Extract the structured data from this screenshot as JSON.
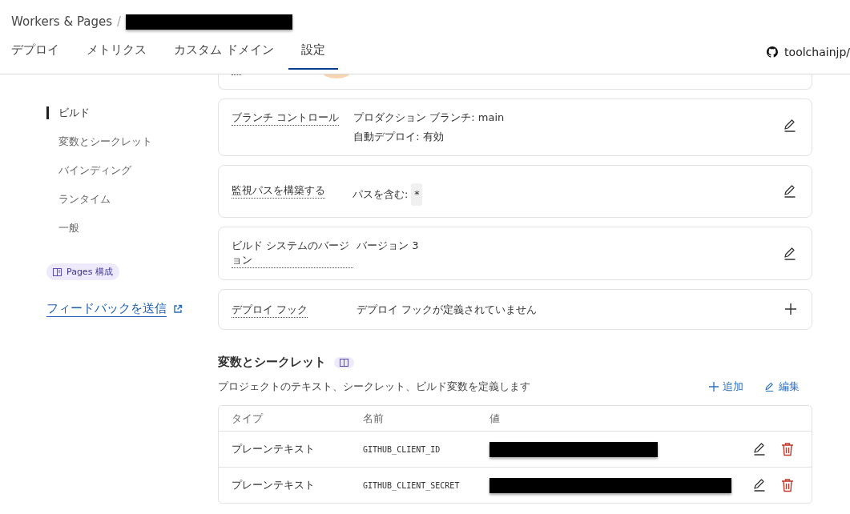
{
  "breadcrumb": {
    "root": "Workers & Pages",
    "separator": "/"
  },
  "tabs": [
    {
      "label": "デプロイ",
      "selected": false
    },
    {
      "label": "メトリクス",
      "selected": false
    },
    {
      "label": "カスタム ドメイン",
      "selected": false
    },
    {
      "label": "設定",
      "selected": true
    }
  ],
  "repo": {
    "name": "toolchainjp/"
  },
  "sidebar": {
    "items": [
      {
        "label": "ビルド",
        "selected": true
      },
      {
        "label": "変数とシークレット",
        "selected": false
      },
      {
        "label": "バインディング",
        "selected": false
      },
      {
        "label": "ランタイム",
        "selected": false
      },
      {
        "label": "一般",
        "selected": false
      }
    ],
    "badge": "Pages 構成",
    "feedback_link": "フィードバックを送信"
  },
  "settings": [
    {
      "label": "ブランチ コントロール",
      "values": [
        {
          "text": "プロダクション ブランチ: main"
        },
        {
          "text": "自動デプロイ: 有効"
        }
      ],
      "kind": "editable"
    },
    {
      "label": "監視パスを構築する",
      "values": [
        {
          "text": "パスを含む:",
          "code": "*"
        }
      ],
      "kind": "editable"
    },
    {
      "label": "ビルド システムのバージョン",
      "values": [
        {
          "text": "バージョン 3"
        }
      ],
      "kind": "editable"
    },
    {
      "label": "デプロイ フック",
      "values": [
        {
          "text": "デプロイ フックが定義されていません"
        }
      ],
      "kind": "addable"
    }
  ],
  "variables": {
    "title": "変数とシークレット",
    "description": "プロジェクトのテキスト、シークレット、ビルド変数を定義します",
    "add": "追加",
    "edit": "編集",
    "columns": [
      "タイプ",
      "名前",
      "値"
    ],
    "rows": [
      {
        "type": "プレーンテキスト",
        "name": "GITHUB_CLIENT_ID"
      },
      {
        "type": "プレーンテキスト",
        "name": "GITHUB_CLIENT_SECRET"
      }
    ]
  }
}
